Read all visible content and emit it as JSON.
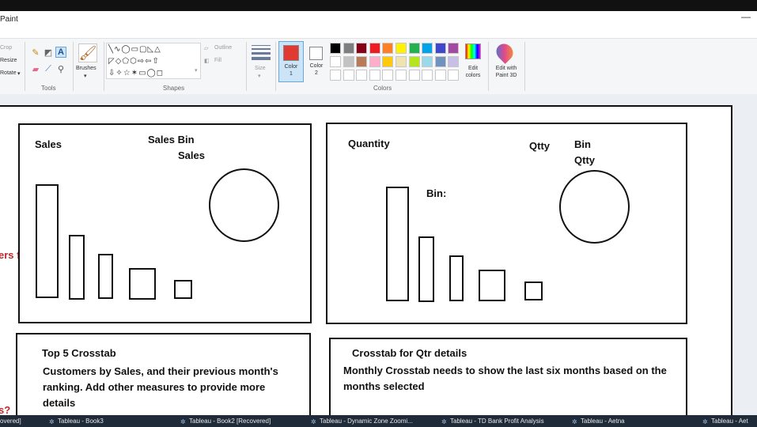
{
  "app": {
    "title": "Paint"
  },
  "ribbon": {
    "image_group": {
      "crop": "Crop",
      "resize": "Resize",
      "rotate": "Rotate"
    },
    "tools": {
      "label": "Tools"
    },
    "brushes": {
      "label": "Brushes"
    },
    "shapes": {
      "label": "Shapes",
      "outline": "Outline",
      "fill": "Fill",
      "glyphs": [
        "╲∿◯▭▢◺△",
        "◸◇⬠⬡⇨⇦⇧",
        "⇩✧☆✶▭◯◻"
      ]
    },
    "size": {
      "label": "Size"
    },
    "color1": {
      "label": "Color",
      "num": "1",
      "value": "#e03a32"
    },
    "color2": {
      "label": "Color",
      "num": "2",
      "value": "#ffffff"
    },
    "colors": {
      "label": "Colors"
    },
    "palette_row1": [
      "#000000",
      "#7f7f7f",
      "#880015",
      "#ed1c24",
      "#ff7f27",
      "#fff200",
      "#22b14c",
      "#00a2e8",
      "#3f48cc",
      "#a349a4"
    ],
    "palette_row2": [
      "#ffffff",
      "#c3c3c3",
      "#b97a57",
      "#ffaec9",
      "#ffc90e",
      "#efe4b0",
      "#b5e61d",
      "#99d9ea",
      "#7092be",
      "#c8bfe7"
    ],
    "edit_colors": {
      "line1": "Edit",
      "line2": "colors"
    },
    "paint3d": {
      "line1": "Edit with",
      "line2": "Paint 3D"
    }
  },
  "canvas": {
    "left_partial": {
      "text1": "ers from",
      "text2": "s?"
    },
    "sales_panel": {
      "title": "Sales",
      "bin_label": "Sales Bin",
      "bin_sub": "Sales"
    },
    "quantity_panel": {
      "title": "Quantity",
      "qtty": "Qtty",
      "bin_label": "Bin",
      "bin_sub": "Qtty",
      "bin_colon": "Bin:"
    },
    "top5_panel": {
      "title": "Top 5 Crosstab",
      "desc": "Customers by Sales, and their previous month's ranking. Add other measures to provide more details"
    },
    "qtr_panel": {
      "title": "Crosstab for Qtr details",
      "desc": "Monthly Crosstab needs to show the last six months based on the months selected"
    }
  },
  "taskbar": {
    "items": [
      "overed]",
      "Tableau - Book3",
      "Tableau - Book2 [Recovered]",
      "Tableau - Dynamic Zone Zoomi...",
      "Tableau - TD Bank Profit Analysis",
      "Tableau - Aetna",
      "Tableau - Aet"
    ]
  }
}
